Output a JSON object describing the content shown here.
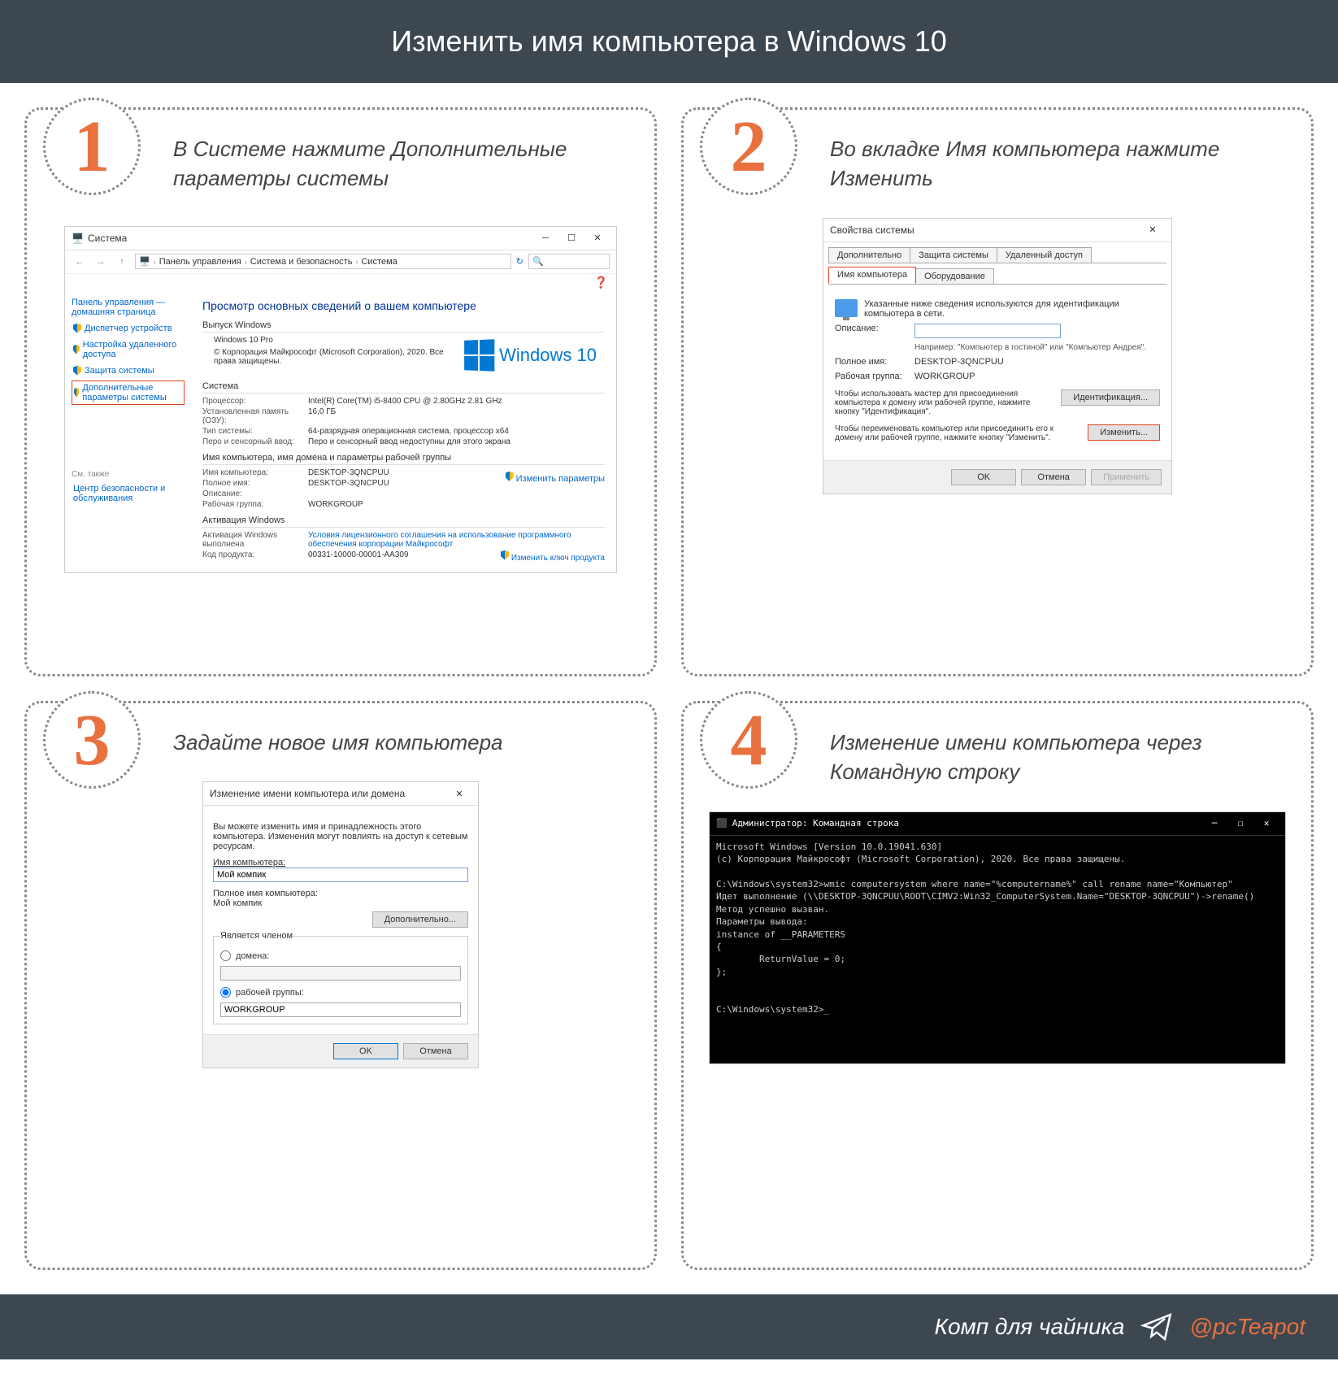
{
  "header": "Изменить имя компьютера в Windows 10",
  "footer": {
    "brand": "Комп для чайника",
    "handle": "@pcTeapot"
  },
  "steps": [
    {
      "num": "1",
      "title_pre": "В ",
      "title_em1": "Системе",
      "title_mid": " нажмите ",
      "title_em2": "Дополнительные параметры системы"
    },
    {
      "num": "2",
      "title_pre": "Во вкладке ",
      "title_em1": "Имя компьютера",
      "title_mid": " нажмите ",
      "title_em2": "Изменить"
    },
    {
      "num": "3",
      "title_pre": "Задайте новое имя компьютера",
      "title_em1": "",
      "title_mid": "",
      "title_em2": ""
    },
    {
      "num": "4",
      "title_pre": "Изменение имени компьютера через ",
      "title_em1": "Командную строку",
      "title_mid": "",
      "title_em2": ""
    }
  ],
  "sys": {
    "title": "Система",
    "crumbs": [
      "Панель управления",
      "Система и безопасность",
      "Система"
    ],
    "search_ph": "",
    "sidebar": {
      "head": "Панель управления — домашняя страница",
      "items": [
        "Диспетчер устройств",
        "Настройка удаленного доступа",
        "Защита системы",
        "Дополнительные параметры системы"
      ],
      "see_also": "См. также",
      "security": "Центр безопасности и обслуживания"
    },
    "main_heading": "Просмотр основных сведений о вашем компьютере",
    "win_release": "Выпуск Windows",
    "win_edition": "Windows 10 Pro",
    "win_copyright": "© Корпорация Майкрософт (Microsoft Corporation), 2020. Все права защищены.",
    "win10_label": "Windows 10",
    "sys_section": "Система",
    "rows1": [
      {
        "l": "Процессор:",
        "v": "Intel(R) Core(TM) i5-8400 CPU @ 2.80GHz  2.81 GHz"
      },
      {
        "l": "Установленная память (ОЗУ):",
        "v": "16,0 ГБ"
      },
      {
        "l": "Тип системы:",
        "v": "64-разрядная операционная система, процессор x64"
      },
      {
        "l": "Перо и сенсорный ввод:",
        "v": "Перо и сенсорный ввод недоступны для этого экрана"
      }
    ],
    "name_section": "Имя компьютера, имя домена и параметры рабочей группы",
    "rows2": [
      {
        "l": "Имя компьютера:",
        "v": "DESKTOP-3QNCPUU"
      },
      {
        "l": "Полное имя:",
        "v": "DESKTOP-3QNCPUU"
      },
      {
        "l": "Описание:",
        "v": ""
      },
      {
        "l": "Рабочая группа:",
        "v": "WORKGROUP"
      }
    ],
    "change_params": "Изменить параметры",
    "activation_section": "Активация Windows",
    "activation_done": "Активация Windows выполнена",
    "license_link": "Условия лицензионного соглашения на использование программного обеспечения корпорации Майкрософт",
    "product_key_label": "Код продукта: ",
    "product_key": "00331-10000-00001-AA309",
    "change_key": "Изменить ключ продукта"
  },
  "props": {
    "title": "Свойства системы",
    "tabs_row1": [
      "Дополнительно",
      "Защита системы",
      "Удаленный доступ"
    ],
    "tabs_row2": [
      "Имя компьютера",
      "Оборудование"
    ],
    "intro": "Указанные ниже сведения используются для идентификации компьютера в сети.",
    "desc_label": "Описание:",
    "desc_hint": "Например: \"Компьютер в гостиной\" или \"Компьютер Андрея\".",
    "fullname_label": "Полное имя:",
    "fullname_value": "DESKTOP-3QNCPUU",
    "workgroup_label": "Рабочая группа:",
    "workgroup_value": "WORKGROUP",
    "ident_text": "Чтобы использовать мастер для присоединения компьютера к домену или рабочей группе, нажмите кнопку \"Идентификация\".",
    "ident_btn": "Идентификация...",
    "change_text": "Чтобы переименовать компьютер или присоединить его к домену или рабочей группе, нажмите кнопку \"Изменить\".",
    "change_btn": "Изменить...",
    "ok": "OK",
    "cancel": "Отмена",
    "apply": "Применить"
  },
  "rename": {
    "title": "Изменение имени компьютера или домена",
    "intro": "Вы можете изменить имя и принадлежность этого компьютера. Изменения могут повлиять на доступ к сетевым ресурсам.",
    "name_label": "Имя компьютера:",
    "name_value": "Мой компик",
    "fullname_label": "Полное имя компьютера:",
    "fullname_value": "Мой компик",
    "more_btn": "Дополнительно...",
    "member_label": "Является членом",
    "domain_radio": "домена:",
    "workgroup_radio": "рабочей группы:",
    "workgroup_value": "WORKGROUP",
    "ok": "OK",
    "cancel": "Отмена"
  },
  "cmd": {
    "title": "Администратор: Командная строка",
    "lines": [
      "Microsoft Windows [Version 10.0.19041.630]",
      "(c) Корпорация Майкрософт (Microsoft Corporation), 2020. Все права защищены.",
      "",
      "C:\\Windows\\system32>wmic computersystem where name=\"%computername%\" call rename name=\"Компьютер\"",
      "Идет выполнение (\\\\DESKTOP-3QNCPUU\\ROOT\\CIMV2:Win32_ComputerSystem.Name=\"DESKTOP-3QNCPUU\")->rename()",
      "Метод успешно вызван.",
      "Параметры вывода:",
      "instance of __PARAMETERS",
      "{",
      "        ReturnValue = 0;",
      "};",
      "",
      "",
      "C:\\Windows\\system32>_"
    ]
  }
}
